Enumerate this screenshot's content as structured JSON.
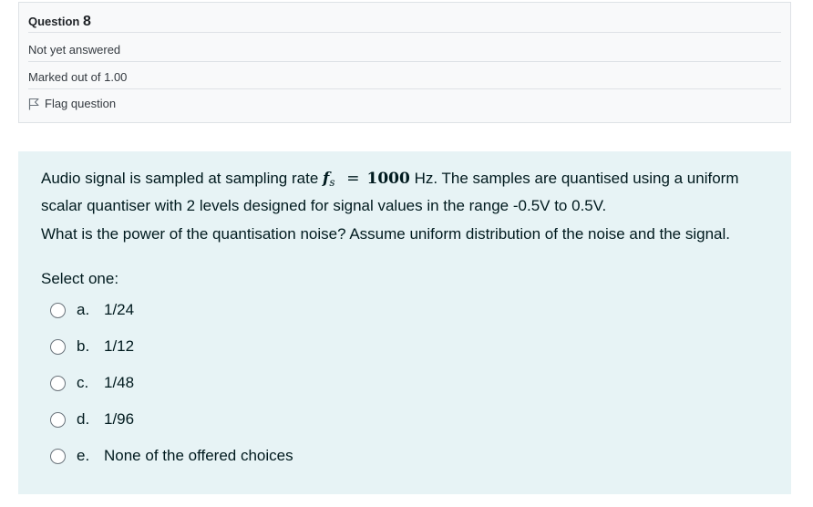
{
  "info": {
    "question_label": "Question",
    "question_number": "8",
    "state": "Not yet answered",
    "grade": "Marked out of 1.00",
    "flag_label": "Flag question"
  },
  "question": {
    "text_before": "Audio signal is sampled at sampling rate",
    "math_var": "f",
    "math_sub": "s",
    "math_eq": "=",
    "math_value": "1000",
    "text_after": "Hz. The samples are quantised using a uniform scalar quantiser with 2 levels designed for signal values in the range -0.5V to 0.5V.",
    "prompt": "What is the power of the quantisation noise? Assume uniform distribution of the noise and the signal.",
    "select_label": "Select one:",
    "answers": [
      {
        "letter": "a.",
        "text": "1/24"
      },
      {
        "letter": "b.",
        "text": "1/12"
      },
      {
        "letter": "c.",
        "text": "1/48"
      },
      {
        "letter": "d.",
        "text": "1/96"
      },
      {
        "letter": "e.",
        "text": "None of the offered choices"
      }
    ]
  },
  "colors": {
    "info_bg": "#f8f9fa",
    "content_bg": "#e7f3f5",
    "text": "#001a1e"
  }
}
